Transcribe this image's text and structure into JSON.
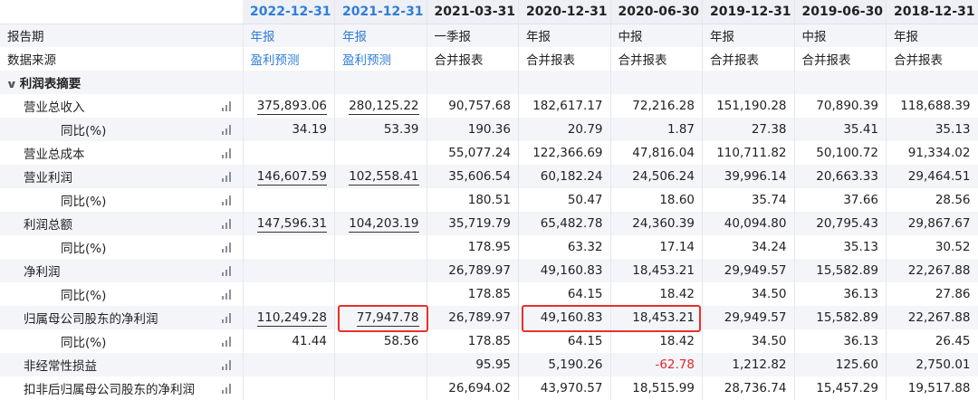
{
  "columns": [
    "2022-12-31",
    "2021-12-31",
    "2021-03-31",
    "2020-12-31",
    "2020-06-30",
    "2019-12-31",
    "2019-06-30",
    "2018-12-31"
  ],
  "rows": {
    "report_period": {
      "label": "报告期",
      "values": [
        "年报",
        "年报",
        "一季报",
        "年报",
        "中报",
        "年报",
        "中报",
        "年报"
      ]
    },
    "data_source": {
      "label": "数据来源",
      "values": [
        "盈利预测",
        "盈利预测",
        "合并报表",
        "合并报表",
        "合并报表",
        "合并报表",
        "合并报表",
        "合并报表"
      ]
    },
    "section": {
      "label": "利润表摘要"
    },
    "revenue": {
      "label": "营业总收入",
      "values": [
        "375,893.06",
        "280,125.22",
        "90,757.68",
        "182,617.17",
        "72,216.28",
        "151,190.28",
        "70,890.39",
        "118,688.39"
      ]
    },
    "revenue_yoy": {
      "label": "同比(%)",
      "values": [
        "34.19",
        "53.39",
        "190.36",
        "20.79",
        "1.87",
        "27.38",
        "35.41",
        "35.13"
      ]
    },
    "total_cost": {
      "label": "营业总成本",
      "values": [
        "",
        "",
        "55,077.24",
        "122,366.69",
        "47,816.04",
        "110,711.82",
        "50,100.72",
        "91,334.02"
      ]
    },
    "op_profit": {
      "label": "营业利润",
      "values": [
        "146,607.59",
        "102,558.41",
        "35,606.54",
        "60,182.24",
        "24,506.24",
        "39,996.14",
        "20,663.33",
        "29,464.51"
      ]
    },
    "op_profit_yoy": {
      "label": "同比(%)",
      "values": [
        "",
        "",
        "180.51",
        "50.47",
        "18.60",
        "35.74",
        "37.66",
        "28.56"
      ]
    },
    "total_profit": {
      "label": "利润总额",
      "values": [
        "147,596.31",
        "104,203.19",
        "35,719.79",
        "65,482.78",
        "24,360.39",
        "40,094.80",
        "20,795.43",
        "29,867.67"
      ]
    },
    "total_profit_yoy": {
      "label": "同比(%)",
      "values": [
        "",
        "",
        "178.95",
        "63.32",
        "17.14",
        "34.24",
        "35.13",
        "30.52"
      ]
    },
    "net_profit": {
      "label": "净利润",
      "values": [
        "",
        "",
        "26,789.97",
        "49,160.83",
        "18,453.21",
        "29,949.57",
        "15,582.89",
        "22,267.88"
      ]
    },
    "net_profit_yoy": {
      "label": "同比(%)",
      "values": [
        "",
        "",
        "178.85",
        "64.15",
        "18.42",
        "34.50",
        "36.13",
        "27.86"
      ]
    },
    "parent_net_profit": {
      "label": "归属母公司股东的净利润",
      "values": [
        "110,249.28",
        "77,947.78",
        "26,789.97",
        "49,160.83",
        "18,453.21",
        "29,949.57",
        "15,582.89",
        "22,267.88"
      ]
    },
    "parent_net_profit_yoy": {
      "label": "同比(%)",
      "values": [
        "41.44",
        "58.56",
        "178.85",
        "64.15",
        "18.42",
        "34.50",
        "36.13",
        "26.45"
      ]
    },
    "non_recurring": {
      "label": "非经常性损益",
      "values": [
        "",
        "",
        "95.95",
        "5,190.26",
        "-62.78",
        "1,212.82",
        "125.60",
        "2,750.01"
      ]
    },
    "deducted_parent_net_profit": {
      "label": "扣非后归属母公司股东的净利润",
      "values": [
        "",
        "",
        "26,694.02",
        "43,970.57",
        "18,515.99",
        "28,736.74",
        "15,457.29",
        "19,517.88"
      ]
    }
  },
  "icons": {
    "row_chart": "bar-chart-icon",
    "section_toggle": "chevron-down-icon"
  },
  "colors": {
    "accent_blue": "#2f7ed8",
    "negative_red": "#e0282c",
    "highlight_box": "#e8302a"
  }
}
